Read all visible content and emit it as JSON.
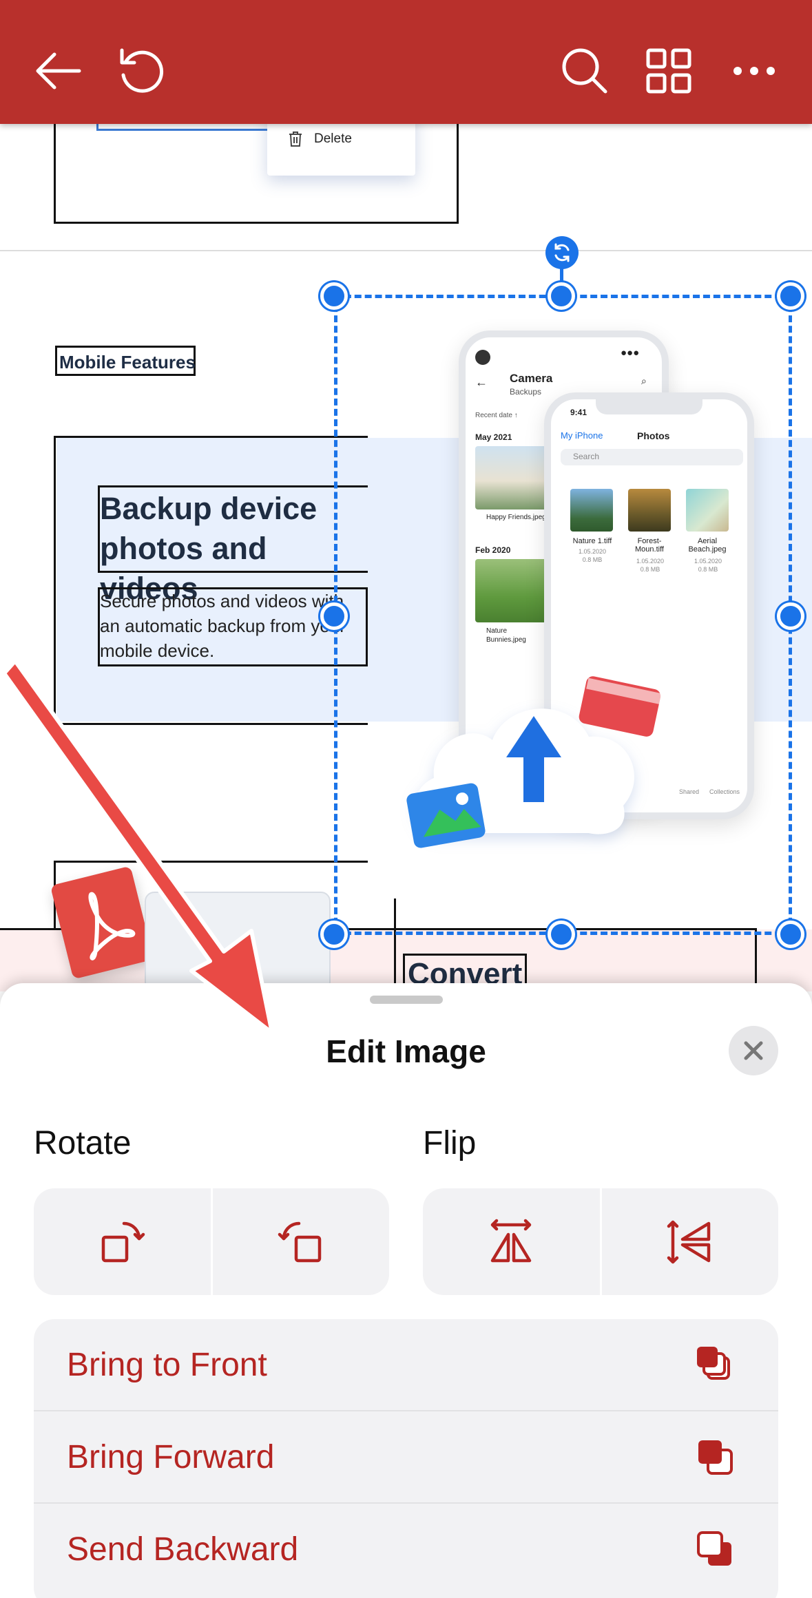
{
  "toolbar": {
    "back_icon": "arrow-left-icon",
    "undo_icon": "undo-icon",
    "search_icon": "search-icon",
    "grid_icon": "grid-icon",
    "more_icon": "more-horizontal-icon",
    "background": "#b8302c"
  },
  "document": {
    "context_menu_item": "Delete",
    "section_heading": "Mobile Features",
    "feature_title": "Backup device photos and videos",
    "feature_body": "Secure photos and videos with an automatic backup from your mobile device.",
    "next_heading": "Convert",
    "phone_back": {
      "title": "Camera",
      "subtitle": "Backups",
      "sort": "Recent date ↑",
      "group1": "May 2021",
      "file1": "Happy Friends.jpeg",
      "group2": "Feb 2020",
      "file2": "Nature Bunnies.jpeg"
    },
    "phone_front": {
      "time": "9:41",
      "back": "My iPhone",
      "title": "Photos",
      "search": "Search",
      "photos": [
        {
          "name": "Nature 1.tiff",
          "date": "1.05.2020",
          "size": "0.8 MB"
        },
        {
          "name": "Forest-Moun.tiff",
          "date": "1.05.2020",
          "size": "0.8 MB"
        },
        {
          "name": "Aerial Beach.jpeg",
          "date": "1.05.2020",
          "size": "0.8 MB"
        }
      ],
      "tabs": [
        "Shared",
        "Collections"
      ]
    },
    "selection_color": "#1a73e8"
  },
  "sheet": {
    "title": "Edit Image",
    "close_icon": "close-icon",
    "rotate_label": "Rotate",
    "flip_label": "Flip",
    "rotate_buttons": [
      "rotate-left-icon",
      "rotate-right-icon"
    ],
    "flip_buttons": [
      "flip-horizontal-icon",
      "flip-vertical-icon"
    ],
    "arrange": [
      {
        "label": "Bring to Front",
        "icon": "bring-to-front-icon"
      },
      {
        "label": "Bring Forward",
        "icon": "bring-forward-icon"
      },
      {
        "label": "Send Backward",
        "icon": "send-backward-icon"
      }
    ],
    "accent": "#b52522"
  }
}
